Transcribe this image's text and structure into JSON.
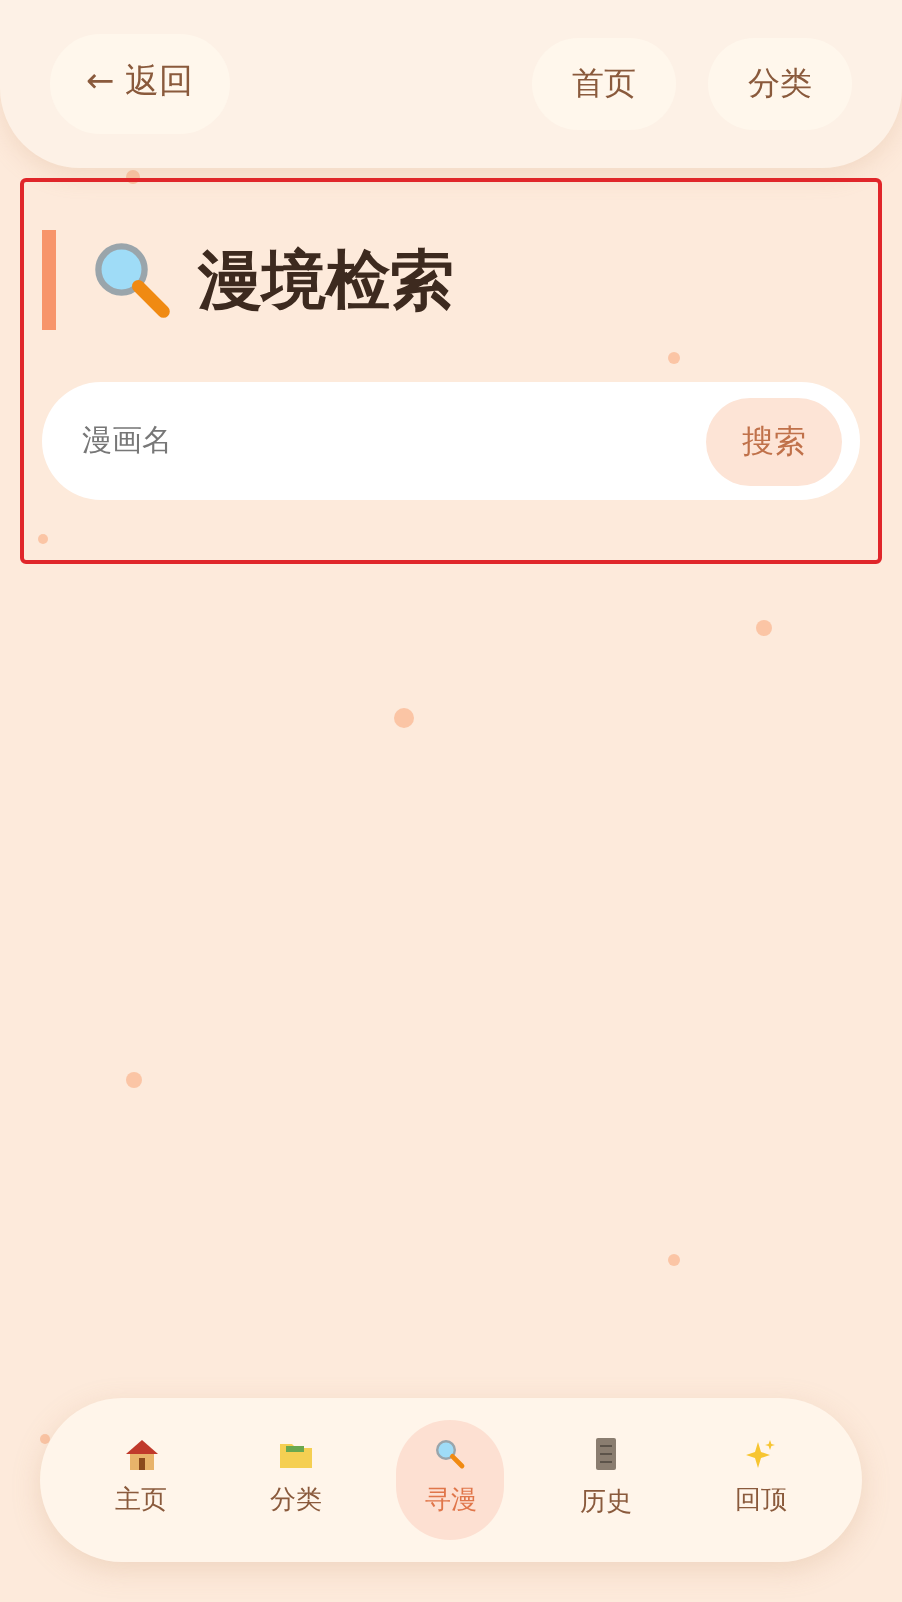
{
  "header": {
    "back": "← 返回",
    "links": [
      "首页",
      "分类"
    ]
  },
  "search_section": {
    "title": "漫境检索",
    "search": {
      "placeholder": "漫画名",
      "button": "搜索"
    }
  },
  "bottom_nav": [
    {
      "kind": "home",
      "label": "主页",
      "selected": false
    },
    {
      "kind": "folder",
      "label": "分类",
      "selected": false
    },
    {
      "kind": "search",
      "label": "寻漫",
      "selected": true
    },
    {
      "kind": "scroll",
      "label": "历史",
      "selected": false
    },
    {
      "kind": "sparkle",
      "label": "回顶",
      "selected": false
    }
  ]
}
